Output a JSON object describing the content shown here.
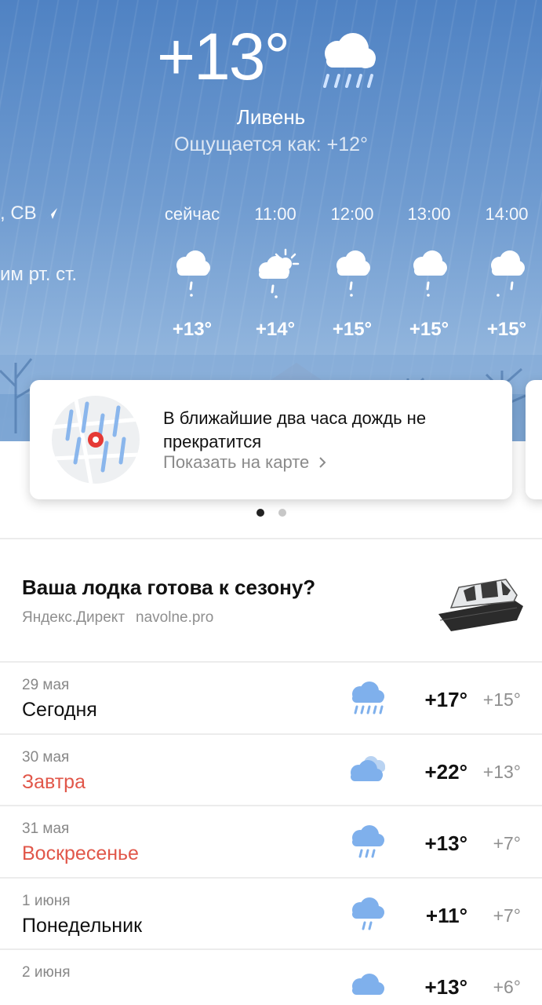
{
  "current": {
    "temperature": "+13°",
    "condition": "Ливень",
    "feels_like": "Ощущается как: +12°",
    "wind_partial": ", СВ",
    "pressure_partial": "им рт. ст.",
    "icon": "cloud-heavy-rain-icon"
  },
  "hourly": [
    {
      "time": "сейчас",
      "temp": "+13°",
      "icon": "cloud-light-rain-icon"
    },
    {
      "time": "11:00",
      "temp": "+14°",
      "icon": "sun-cloud-rain-icon"
    },
    {
      "time": "12:00",
      "temp": "+15°",
      "icon": "cloud-light-rain-icon"
    },
    {
      "time": "13:00",
      "temp": "+15°",
      "icon": "cloud-light-rain-icon"
    },
    {
      "time": "14:00",
      "temp": "+15°",
      "icon": "cloud-light-rain-icon"
    }
  ],
  "nowcast_card": {
    "text": "В ближайшие два часа дождь не прекратится",
    "link": "Показать на карте"
  },
  "ad": {
    "title": "Ваша лодка готова к сезону?",
    "source": "Яндекс.Директ",
    "domain": "navolne.pro"
  },
  "daily": [
    {
      "date": "29 мая",
      "name": "Сегодня",
      "hi": "+17°",
      "lo": "+15°",
      "weekend": false,
      "icon": "cloud-heavy-rain-icon"
    },
    {
      "date": "30 мая",
      "name": "Завтра",
      "hi": "+22°",
      "lo": "+13°",
      "weekend": true,
      "icon": "cloudy-icon"
    },
    {
      "date": "31 мая",
      "name": "Воскресенье",
      "hi": "+13°",
      "lo": "+7°",
      "weekend": true,
      "icon": "cloud-rain-icon"
    },
    {
      "date": "1 июня",
      "name": "Понедельник",
      "hi": "+11°",
      "lo": "+7°",
      "weekend": false,
      "icon": "cloud-light-rain-icon"
    },
    {
      "date": "2 июня",
      "name": "",
      "hi": "+13°",
      "lo": "+6°",
      "weekend": false,
      "icon": "cloud-icon"
    }
  ],
  "colors": {
    "weekend": "#e1574a",
    "icon_blue": "#7fb0ec"
  }
}
